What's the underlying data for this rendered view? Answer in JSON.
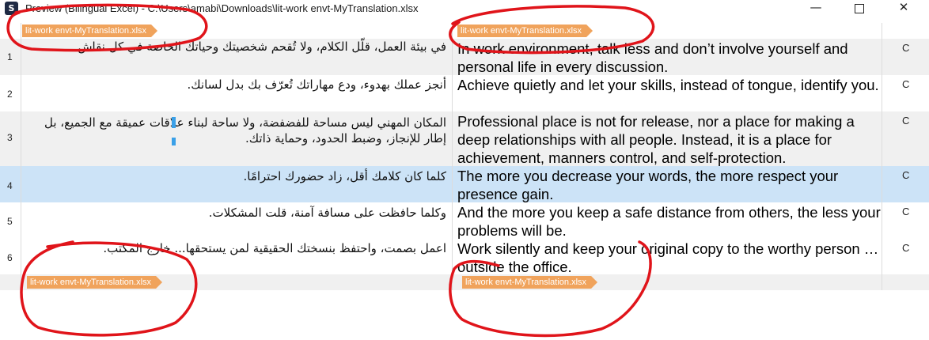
{
  "window": {
    "app_icon_letter": "S",
    "title": "Preview (Bilingual Excel) - C:\\Users\\amabi\\Downloads\\lit-work envt-MyTranslation.xlsx",
    "min_glyph": "—",
    "close_glyph": "✕"
  },
  "file_tags": {
    "source_top": "lit-work envt-MyTranslation.xlsx",
    "target_top": "lit-work envt-MyTranslation.xlsx",
    "source_bottom": "lit-work envt-MyTranslation.xlsx",
    "target_bottom": "lit-work envt-MyTranslation.xlsx"
  },
  "rows": [
    {
      "num": "1",
      "source": "في بيئة العمل، قلّل الكلام، ولا تُقحم شخصيتك وحياتك الخاصة في كل نقاش.",
      "target": "In work environment, talk less and don’t involve yourself and personal life in every discussion.",
      "status": "C"
    },
    {
      "num": "2",
      "source": "أنجز عملك بهدوء، ودع مهاراتك تُعرّف بك بدل لسانك.",
      "target": "Achieve quietly and let your skills, instead of tongue, identify you.",
      "status": "C"
    },
    {
      "num": "3",
      "source": "المكان المهني ليس مساحة للفضفضة، ولا ساحة لبناء علاقات عميقة مع الجميع، بل إطار للإنجاز، وضبط الحدود، وحماية ذاتك.",
      "target": "Professional place is not for release, nor a place for making a deep relationships with all people. Instead, it is a place for achievement, manners control, and self-protection.",
      "status": "C"
    },
    {
      "num": "4",
      "source": "كلما كان كلامك أقل، زاد حضورك احترامًا.",
      "target": "The more you decrease your words, the more respect your presence gain.",
      "status": "C"
    },
    {
      "num": "5",
      "source": "وكلما حافظت على مسافة آمنة، قلت المشكلات.",
      "target": "And the more you keep a safe distance from others, the less your problems will be.",
      "status": "C"
    },
    {
      "num": "6",
      "source": "اعمل بصمت، واحتفظ بنسختك الحقيقية لمن يستحقها... خارج المكتب.",
      "target": "Work silently and keep your original copy to the worthy person … outside the office.",
      "status": "C"
    }
  ],
  "colors": {
    "tag_bg": "#f0a35c",
    "row_alt": "#f0f0f0",
    "row_selected": "#cce3f7",
    "annotation_red": "#e0141a"
  }
}
